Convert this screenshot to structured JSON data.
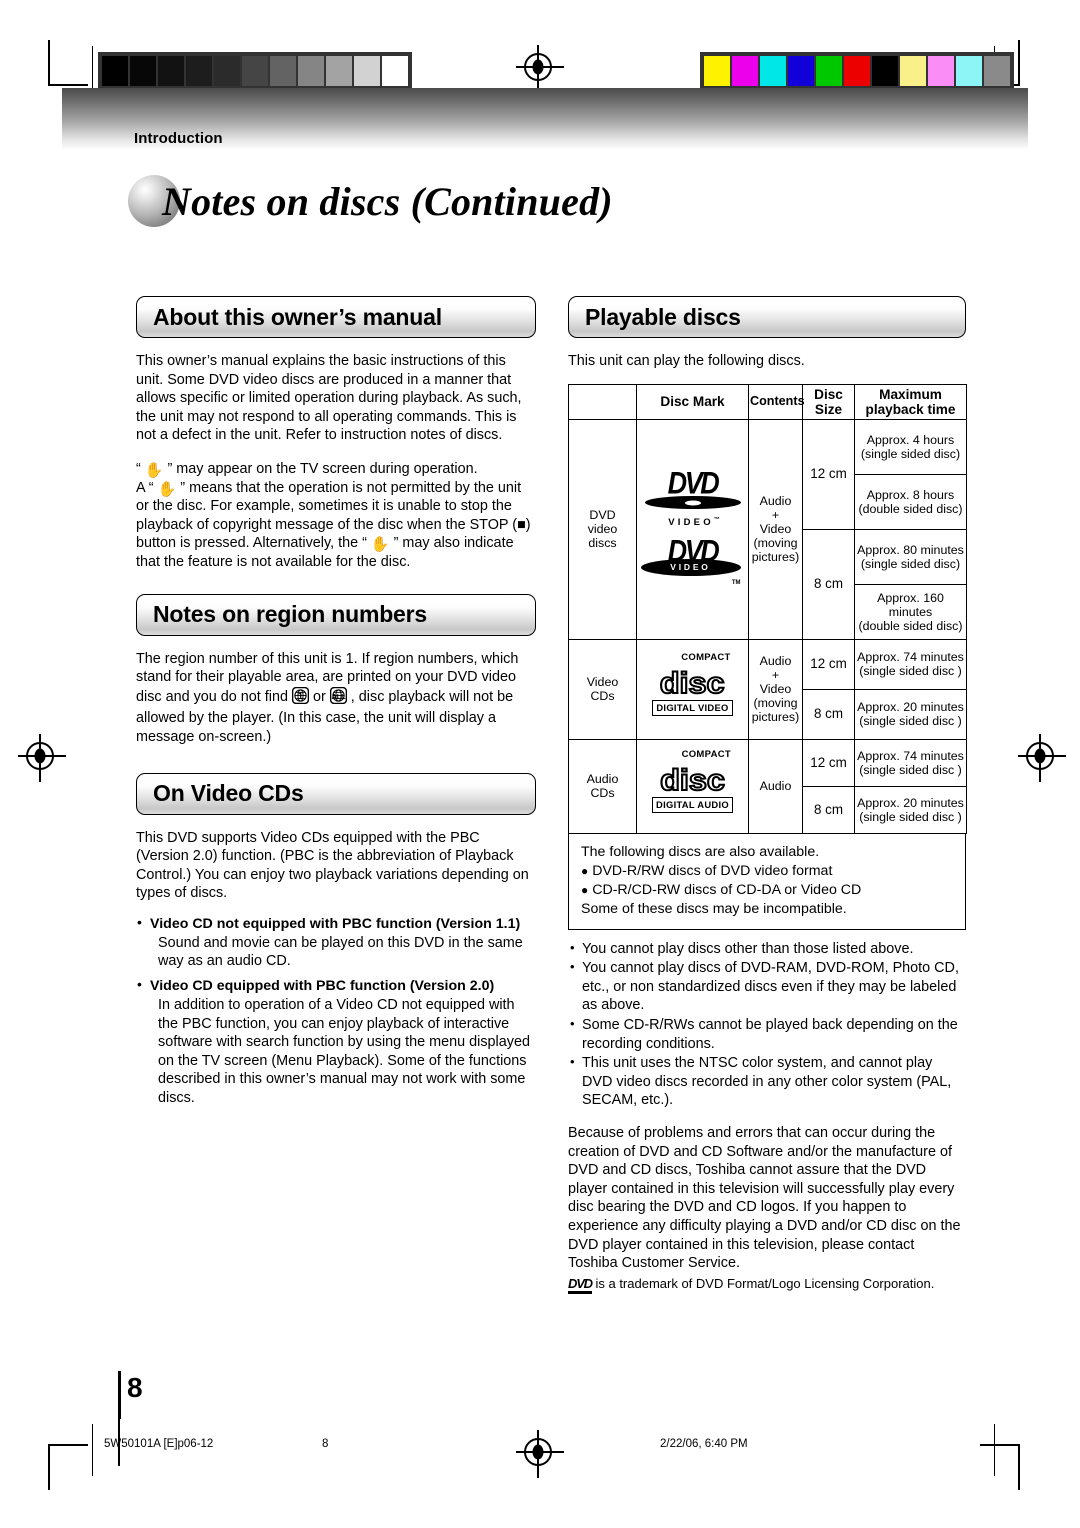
{
  "header": {
    "section_label": "Introduction",
    "page_title": "Notes on discs (Continued)"
  },
  "left_column": {
    "manual_section": {
      "heading": "About this owner’s manual",
      "para1": "This owner’s manual explains the basic instructions of this unit. Some DVD video discs are produced in a manner that allows specific or limited operation during playback. As such, the unit may not respond to all operating commands. This is not a defect in the unit. Refer to instruction notes of discs.",
      "para2_a": " ” may appear on the TV screen during operation.",
      "para2_b": "A “",
      "para2_c": " ” means that the operation is not permitted by the unit or the disc.",
      "para2_d": "For example, sometimes it is unable to stop the playback of copyright message of the disc when the STOP (■) button is pressed. Alternatively, the “",
      "para2_e": " ” may also indicate that the feature is not available for the disc."
    },
    "region_section": {
      "heading": "Notes on region numbers",
      "text_a": "The region number of this unit is 1. If region numbers, which stand for their playable area, are printed on your DVD video disc and you do not find ",
      "text_b": " or ",
      "text_c": " , disc playback will not be allowed by the player. (In this case, the unit will display a message on-screen.)",
      "icon_region_1": "1",
      "icon_region_all": "ALL"
    },
    "videocd_section": {
      "heading": "On Video CDs",
      "intro": "This DVD supports Video CDs equipped with the PBC (Version 2.0) function. (PBC is the abbreviation of Playback Control.) You can enjoy two playback variations depending on types of discs.",
      "bullets": [
        {
          "title": "Video CD not equipped with PBC function (Version 1.1)",
          "body": "Sound and movie can be played on this DVD in the same way as an audio CD."
        },
        {
          "title": "Video CD equipped with PBC function (Version 2.0)",
          "body": "In addition to operation of a Video CD not equipped with the PBC function, you can enjoy playback of interactive software with search function by using the menu displayed on the TV screen (Menu Playback). Some of the functions described in this owner’s manual may not work with some discs."
        }
      ]
    }
  },
  "right_column": {
    "heading": "Playable discs",
    "intro": "This unit can play the following discs.",
    "table": {
      "headers": [
        "",
        "Disc Mark",
        "Contents",
        "Disc Size",
        "Maximum playback time"
      ],
      "header_disc_size_l1": "Disc",
      "header_disc_size_l2": "Size",
      "header_max_l1": "Maximum",
      "header_max_l2": "playback time",
      "rows": [
        {
          "label": "DVD video discs",
          "label_l1": "DVD",
          "label_l2": "video",
          "label_l3": "discs",
          "mark": "dvd-video-logo",
          "contents_l1": "Audio",
          "contents_l2": "+",
          "contents_l3": "Video",
          "contents_l4": "(moving",
          "contents_l5": "pictures)",
          "sizes": [
            {
              "size": "12 cm",
              "times": [
                {
                  "l1": "Approx. 4 hours",
                  "l2": "(single sided disc)"
                },
                {
                  "l1": "Approx. 8 hours",
                  "l2": "(double sided disc)"
                }
              ]
            },
            {
              "size": "8 cm",
              "times": [
                {
                  "l1": "Approx. 80 minutes",
                  "l2": "(single sided disc)"
                },
                {
                  "l1": "Approx. 160 minutes",
                  "l2": "(double sided disc)"
                }
              ]
            }
          ]
        },
        {
          "label": "Video CDs",
          "label_l1": "Video",
          "label_l2": "CDs",
          "mark": "compact-disc-digital-video-logo",
          "mark_word": "disc",
          "mark_top": "COMPACT",
          "mark_band": "DIGITAL VIDEO",
          "contents_l1": "Audio",
          "contents_l2": "+",
          "contents_l3": "Video",
          "contents_l4": "(moving",
          "contents_l5": "pictures)",
          "sizes": [
            {
              "size": "12 cm",
              "times": [
                {
                  "l1": "Approx. 74 minutes",
                  "l2": "(single sided disc )"
                }
              ]
            },
            {
              "size": "8 cm",
              "times": [
                {
                  "l1": "Approx. 20 minutes",
                  "l2": "(single sided disc )"
                }
              ]
            }
          ]
        },
        {
          "label": "Audio CDs",
          "label_l1": "Audio",
          "label_l2": "CDs",
          "mark": "compact-disc-digital-audio-logo",
          "mark_word": "disc",
          "mark_top": "COMPACT",
          "mark_band": "DIGITAL AUDIO",
          "contents_l1": "Audio",
          "sizes": [
            {
              "size": "12 cm",
              "times": [
                {
                  "l1": "Approx. 74 minutes",
                  "l2": "(single sided disc )"
                }
              ]
            },
            {
              "size": "8 cm",
              "times": [
                {
                  "l1": "Approx. 20 minutes",
                  "l2": "(single sided disc )"
                }
              ]
            }
          ]
        }
      ]
    },
    "notebox": {
      "line1": "The following discs are also available.",
      "item1": "DVD-R/RW discs of DVD video format",
      "item2": "CD-R/CD-RW discs of CD-DA or Video CD",
      "line4": "Some of these discs may be incompatible."
    },
    "cautions": [
      "You cannot play discs other than those listed above.",
      "You cannot play discs of DVD-RAM, DVD-ROM, Photo CD, etc., or non standardized discs even if they may be labeled as above.",
      "Some CD-R/RWs cannot be played back depending on the recording conditions.",
      "This unit uses the NTSC color system, and cannot play DVD video discs recorded in any other color system (PAL, SECAM, etc.)."
    ],
    "closing": "Because of problems and errors that can occur during the creation of DVD and CD Software and/or the manufacture of DVD and CD discs, Toshiba cannot assure that the DVD player contained in this television will successfully play every disc bearing the DVD and CD logos.  If you happen to experience any difficulty playing a DVD and/or CD disc on the DVD player contained in this television, please contact Toshiba Customer Service.",
    "trademark_mark": "DVD",
    "trademark_text": " is a trademark of DVD Format/Logo Licensing Corporation."
  },
  "footer": {
    "page_number": "8",
    "file_id": "5W50101A [E]p06-12",
    "page_footer_number": "8",
    "timestamp": "2/22/06, 6:40 PM"
  },
  "calibration": {
    "gray_swatches": [
      "#000000",
      "#070707",
      "#121212",
      "#1d1d1d",
      "#2b2b2b",
      "#454545",
      "#636363",
      "#858585",
      "#a3a3a3",
      "#d2d2d2",
      "#ffffff"
    ],
    "color_swatches": [
      "#fff200",
      "#ec00ec",
      "#00e7e7",
      "#1200d8",
      "#00c800",
      "#ec0000",
      "#000000",
      "#faf08a",
      "#fb8ef6",
      "#8df5f5",
      "#8a8a8a"
    ]
  }
}
